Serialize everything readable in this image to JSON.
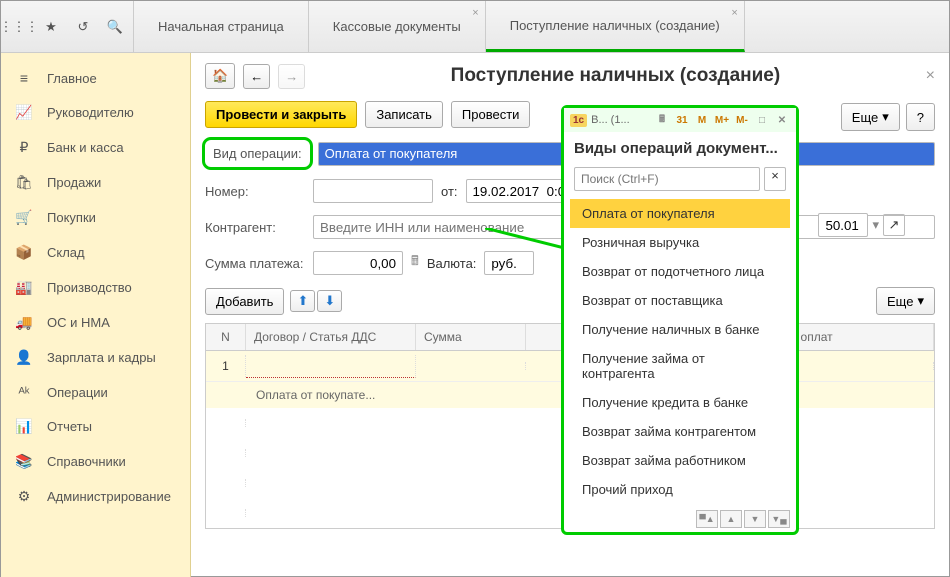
{
  "topTabs": [
    {
      "label": "Начальная страница",
      "closable": false
    },
    {
      "label": "Кассовые документы",
      "closable": true
    },
    {
      "label": "Поступление наличных (создание)",
      "closable": true,
      "active": true
    }
  ],
  "sidebar": [
    {
      "icon": "≡",
      "label": "Главное"
    },
    {
      "icon": "📈",
      "label": "Руководителю"
    },
    {
      "icon": "₽",
      "label": "Банк и касса"
    },
    {
      "icon": "🛍",
      "label": "Продажи"
    },
    {
      "icon": "🛒",
      "label": "Покупки"
    },
    {
      "icon": "📦",
      "label": "Склад"
    },
    {
      "icon": "🏭",
      "label": "Производство"
    },
    {
      "icon": "🚚",
      "label": "ОС и НМА"
    },
    {
      "icon": "👤",
      "label": "Зарплата и кадры"
    },
    {
      "icon": "ᴬᵏ",
      "label": "Операции"
    },
    {
      "icon": "📊",
      "label": "Отчеты"
    },
    {
      "icon": "📚",
      "label": "Справочники"
    },
    {
      "icon": "⚙",
      "label": "Администрирование"
    }
  ],
  "page": {
    "title": "Поступление наличных (создание)",
    "actions": {
      "postClose": "Провести и закрыть",
      "save": "Записать",
      "post": "Провести",
      "more": "Еще",
      "help": "?"
    },
    "form": {
      "opTypeLabel": "Вид операции:",
      "opTypeValue": "Оплата от покупателя",
      "numberLabel": "Номер:",
      "dateLabel": "от:",
      "dateValue": "19.02.2017  0:00",
      "contragentLabel": "Контрагент:",
      "contragentPlaceholder": "Введите ИНН или наименование",
      "sumLabel": "Сумма платежа:",
      "sumValue": "0,00",
      "currencyLabel": "Валюта:",
      "currencyValue": "руб.",
      "accountValue": "50.01",
      "addButton": "Добавить"
    },
    "grid": {
      "cols": {
        "n": "N",
        "contract": "Договор / Статья ДДС",
        "sum": "Сумма",
        "bill": "Счет на оплат"
      },
      "row1": {
        "n": "1",
        "contract": ""
      },
      "row2text": "Оплата от покупате..."
    }
  },
  "popup": {
    "titleShort": "В... (1...",
    "m": "M",
    "mplus": "M+",
    "mminus": "M-",
    "header": "Виды операций документ...",
    "searchPlaceholder": "Поиск (Ctrl+F)",
    "items": [
      "Оплата от покупателя",
      "Розничная выручка",
      "Возврат от подотчетного лица",
      "Возврат от поставщика",
      "Получение наличных в банке",
      "Получение займа от контрагента",
      "Получение кредита в банке",
      "Возврат займа контрагентом",
      "Возврат займа работником",
      "Прочий приход"
    ],
    "selectedIndex": 0
  }
}
